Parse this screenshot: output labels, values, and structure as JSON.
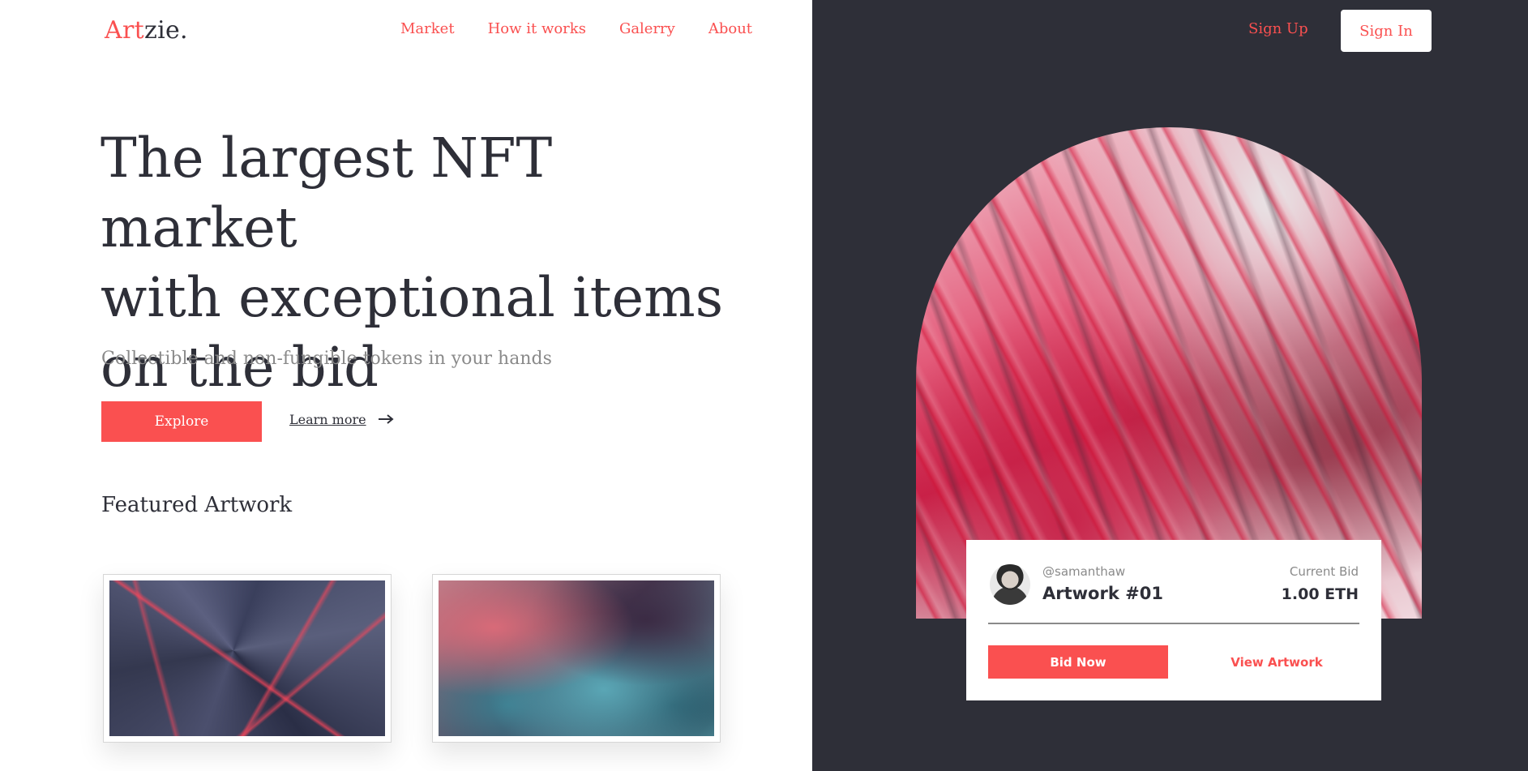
{
  "brand": {
    "logo_accent": "Art",
    "logo_rest": "zie."
  },
  "nav": {
    "items": [
      {
        "label": "Market"
      },
      {
        "label": "How it works"
      },
      {
        "label": "Galerry"
      },
      {
        "label": "About"
      }
    ],
    "sign_up": "Sign Up",
    "sign_in": "Sign In"
  },
  "hero": {
    "title_line1": "The largest NFT market",
    "title_line2": "with exceptional items",
    "title_line3": "on the bid",
    "subtitle": "Collectible and non-fungible tokens in your hands",
    "explore": "Explore",
    "learn_more": "Learn more"
  },
  "featured": {
    "heading": "Featured Artwork"
  },
  "bid_card": {
    "username": "@samanthaw",
    "artwork_name": "Artwork #01",
    "current_bid_label": "Current Bid",
    "current_bid_value": "1.00 ETH",
    "bid_now": "Bid Now",
    "view_artwork": "View Artwork"
  },
  "colors": {
    "accent": "#fa5050",
    "dark": "#2e2f38",
    "muted": "#8a8a8a"
  }
}
